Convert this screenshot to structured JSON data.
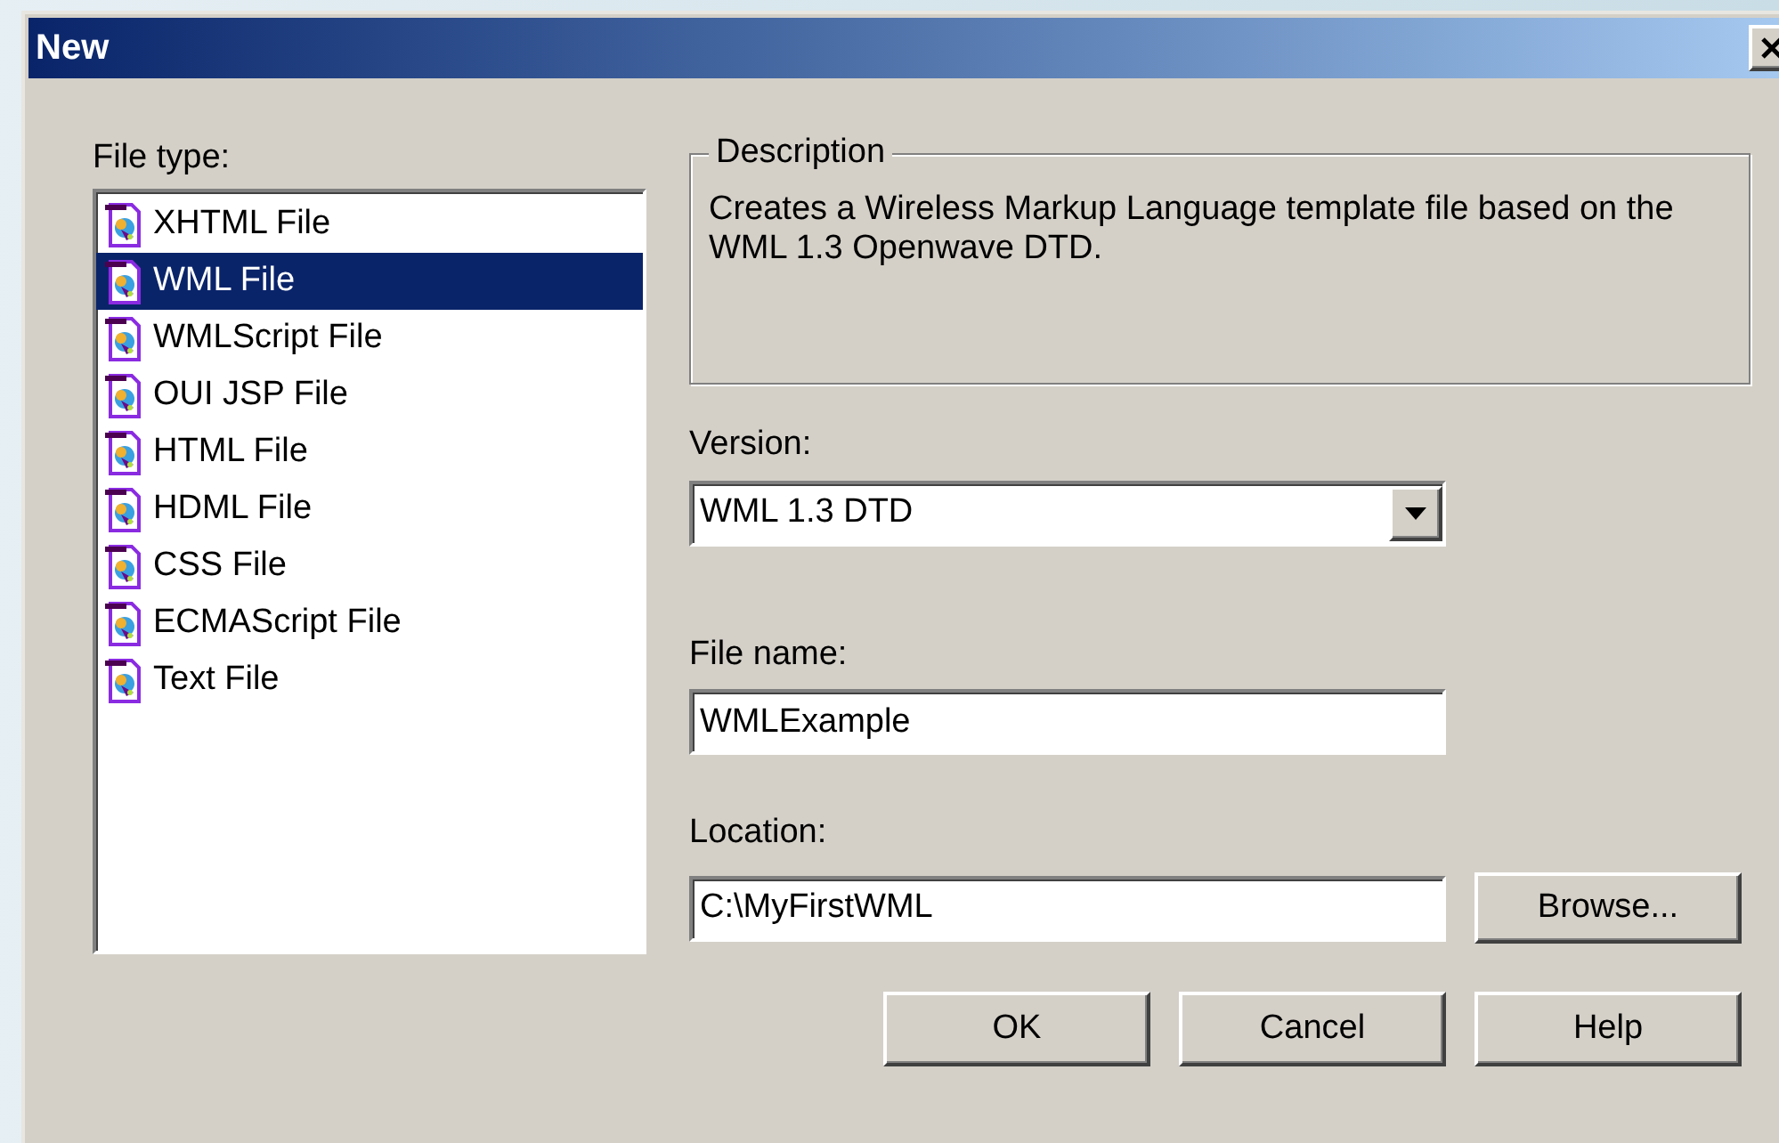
{
  "window": {
    "title": "New"
  },
  "file_type": {
    "label": "File type:",
    "items": [
      {
        "label": "XHTML File",
        "selected": false
      },
      {
        "label": "WML File",
        "selected": true
      },
      {
        "label": "WMLScript File",
        "selected": false
      },
      {
        "label": "OUI JSP File",
        "selected": false
      },
      {
        "label": "HTML File",
        "selected": false
      },
      {
        "label": "HDML File",
        "selected": false
      },
      {
        "label": "CSS File",
        "selected": false
      },
      {
        "label": "ECMAScript File",
        "selected": false
      },
      {
        "label": "Text File",
        "selected": false
      }
    ]
  },
  "description": {
    "label": "Description",
    "text": "Creates a Wireless Markup Language template file based on the WML 1.3 Openwave DTD."
  },
  "version": {
    "label": "Version:",
    "value": "WML 1.3 DTD"
  },
  "file_name": {
    "label": "File name:",
    "value": "WMLExample"
  },
  "location": {
    "label": "Location:",
    "value": "C:\\MyFirstWML",
    "browse": "Browse..."
  },
  "buttons": [
    {
      "label": "OK"
    },
    {
      "label": "Cancel"
    },
    {
      "label": "Help"
    }
  ]
}
